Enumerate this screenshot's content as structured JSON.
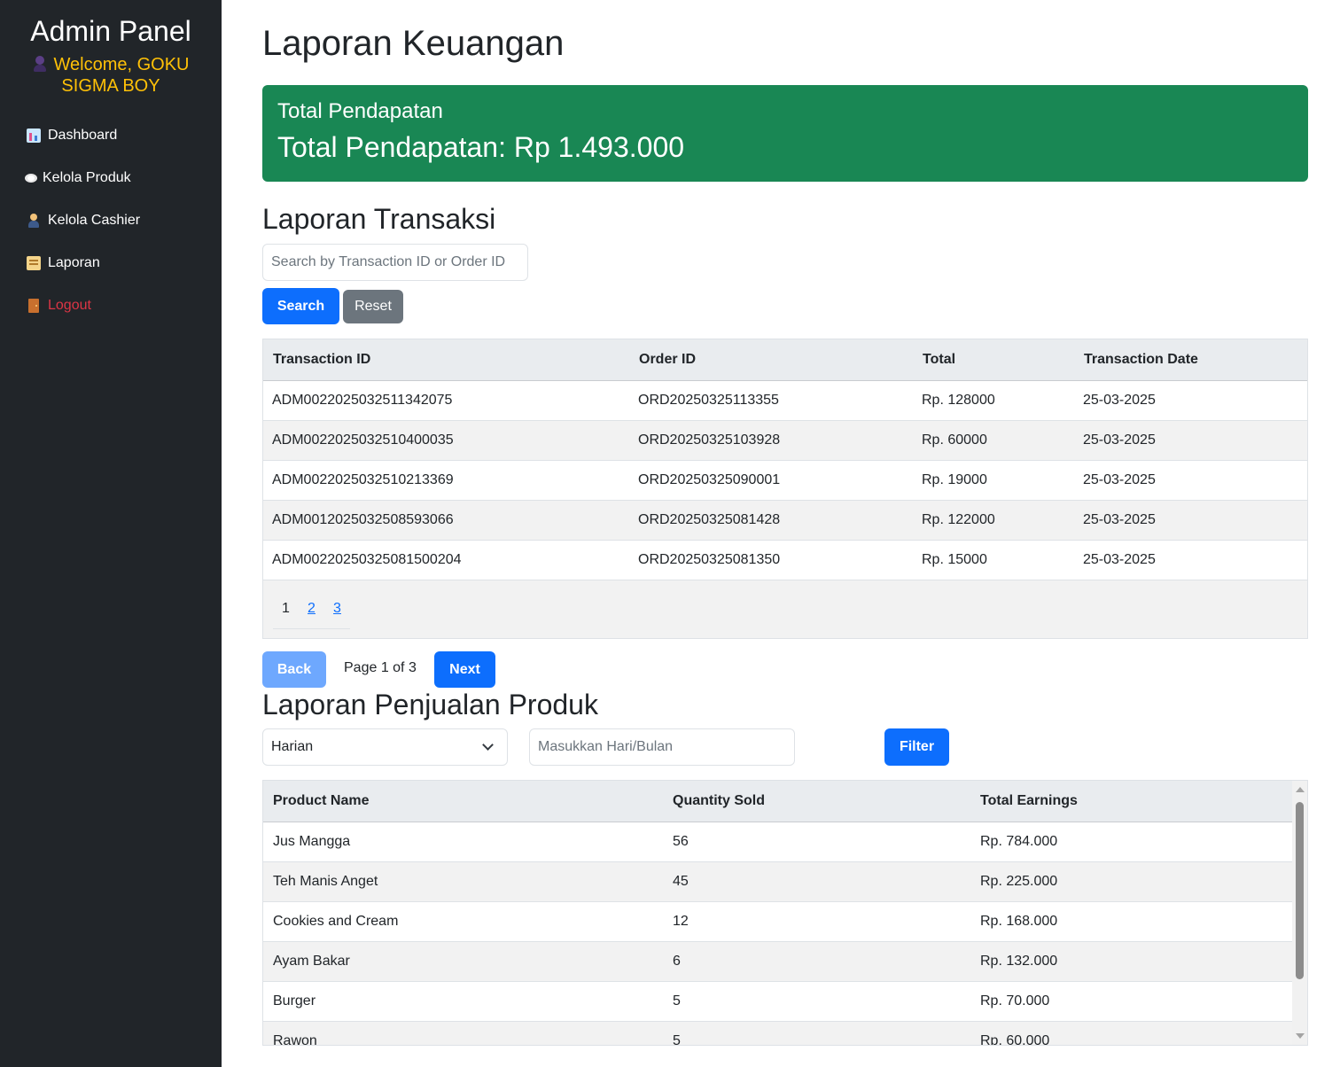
{
  "sidebar": {
    "title": "Admin Panel",
    "welcome_line1": "Welcome, GOKU",
    "welcome_line2": "SIGMA BOY",
    "welcome_icon": "ninja-icon",
    "items": [
      {
        "label": "Dashboard",
        "icon": "bar-chart-icon"
      },
      {
        "label": "Kelola Produk",
        "icon": "plate-icon"
      },
      {
        "label": "Kelola Cashier",
        "icon": "person-icon"
      },
      {
        "label": "Laporan",
        "icon": "scroll-icon"
      },
      {
        "label": "Logout",
        "icon": "door-icon"
      }
    ]
  },
  "page": {
    "title": "Laporan Keuangan"
  },
  "summary_card": {
    "title": "Total Pendapatan",
    "text": "Total Pendapatan: Rp 1.493.000",
    "color": "#198754"
  },
  "transactions": {
    "title": "Laporan Transaksi",
    "search_placeholder": "Search by Transaction ID or Order ID",
    "search_label": "Search",
    "reset_label": "Reset",
    "columns": [
      "Transaction ID",
      "Order ID",
      "Total",
      "Transaction Date"
    ],
    "rows": [
      [
        "ADM0022025032511342075",
        "ORD20250325113355",
        "Rp. 128000",
        "25-03-2025"
      ],
      [
        "ADM0022025032510400035",
        "ORD20250325103928",
        "Rp. 60000",
        "25-03-2025"
      ],
      [
        "ADM0022025032510213369",
        "ORD20250325090001",
        "Rp. 19000",
        "25-03-2025"
      ],
      [
        "ADM0012025032508593066",
        "ORD20250325081428",
        "Rp. 122000",
        "25-03-2025"
      ],
      [
        "ADM00220250325081500204",
        "ORD20250325081350",
        "Rp. 15000",
        "25-03-2025"
      ]
    ],
    "pages": [
      "1",
      "2",
      "3"
    ],
    "current_page": "1",
    "back_label": "Back",
    "next_label": "Next",
    "page_info": "Page 1 of 3"
  },
  "product_sales": {
    "title": "Laporan Penjualan Produk",
    "period_selected": "Harian",
    "date_placeholder": "Masukkan Hari/Bulan",
    "filter_label": "Filter",
    "columns": [
      "Product Name",
      "Quantity Sold",
      "Total Earnings"
    ],
    "rows": [
      [
        "Jus Mangga",
        "56",
        "Rp. 784.000"
      ],
      [
        "Teh Manis Anget",
        "45",
        "Rp. 225.000"
      ],
      [
        "Cookies and Cream",
        "12",
        "Rp. 168.000"
      ],
      [
        "Ayam Bakar",
        "6",
        "Rp. 132.000"
      ],
      [
        "Burger",
        "5",
        "Rp. 70.000"
      ],
      [
        "Rawon",
        "5",
        "Rp. 60.000"
      ]
    ]
  }
}
